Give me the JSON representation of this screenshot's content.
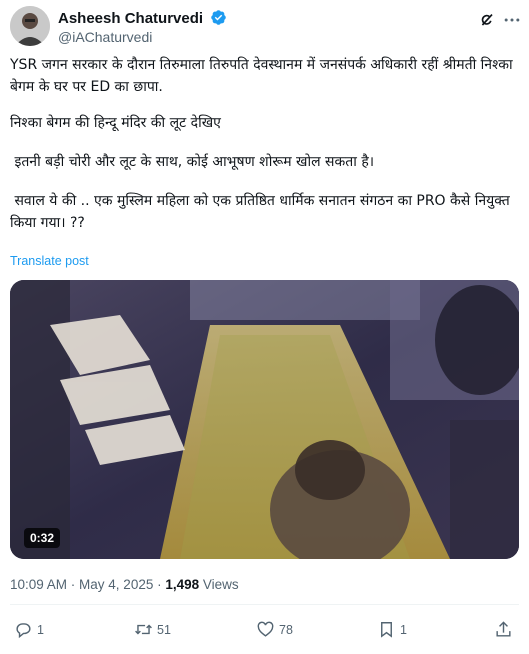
{
  "author": {
    "name": "Asheesh Chaturvedi",
    "handle": "@iAChaturvedi"
  },
  "icons": {
    "verified": "verified-badge-icon",
    "grok": "grok-icon",
    "more": "more-options-icon",
    "reply": "reply-icon",
    "retweet": "retweet-icon",
    "like": "like-icon",
    "bookmark": "bookmark-icon",
    "share": "share-icon"
  },
  "colors": {
    "accent": "#1d9bf0",
    "secondary_text": "#536471"
  },
  "post": {
    "paragraphs": [
      "YSR जगन सरकार के दौरान तिरुमाला तिरुपति देवस्थानम में जनसंपर्क अधिकारी रहीं श्रीमती निश्का बेगम के घर पर ED का छापा.",
      "निश्का बेगम की हिन्दू मंदिर की लूट देखिए",
      " इतनी बड़ी चोरी और लूट के साथ, कोई आभूषण शोरूम खोल सकता है।",
      " सवाल ये की .. एक मुस्लिम महिला को एक प्रतिष्ठित धार्मिक सनातन संगठन का PRO कैसे नियुक्त किया गया। ??"
    ],
    "translate_label": "Translate post"
  },
  "media": {
    "duration": "0:32"
  },
  "meta": {
    "time": "10:09 AM",
    "separator": " · ",
    "date": "May 4, 2025",
    "views_count": "1,498",
    "views_label": " Views"
  },
  "actions": {
    "replies": "1",
    "reposts": "51",
    "likes": "78",
    "bookmarks": "1"
  }
}
